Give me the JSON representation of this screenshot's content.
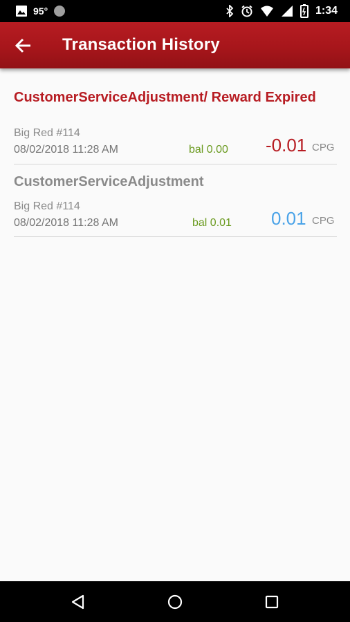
{
  "status_bar": {
    "temperature": "95°",
    "time": "1:34"
  },
  "app_bar": {
    "title": "Transaction History",
    "color": "#b71c22"
  },
  "transactions": [
    {
      "title": "CustomerServiceAdjustment/ Reward Expired",
      "store": "Big Red #114",
      "date": "08/02/2018 11:28 AM",
      "balance": "bal 0.00",
      "amount": "-0.01",
      "unit": "CPG",
      "amount_color": "#b71c22"
    },
    {
      "title": "CustomerServiceAdjustment",
      "store": "Big Red #114",
      "date": "08/02/2018 11:28 AM",
      "balance": "bal 0.01",
      "amount": "0.01",
      "unit": "CPG",
      "amount_color": "#4aa3e8"
    }
  ],
  "nav_bar": {
    "icons": [
      "back-triangle-icon",
      "home-circle-icon",
      "recents-square-icon"
    ]
  }
}
